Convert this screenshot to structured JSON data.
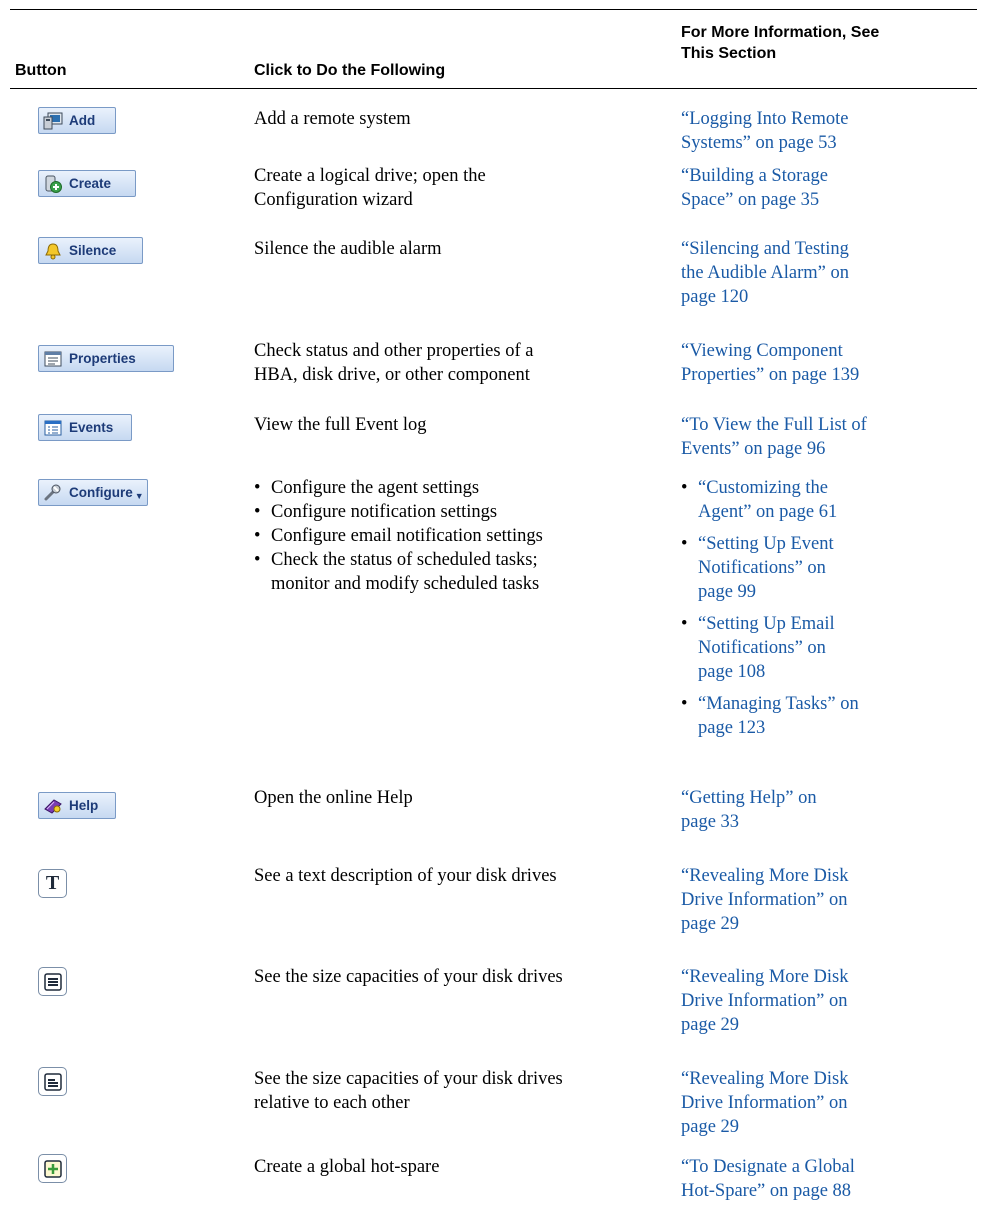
{
  "header": {
    "col1": "Button",
    "col2": "Click to Do the Following",
    "col3_line1": "For More Information, See",
    "col3_line2": "This Section"
  },
  "rows": [
    {
      "button": "Add",
      "desc": [
        "Add a remote system"
      ],
      "ref": [
        "“Logging Into Remote",
        "Systems” on page 53"
      ]
    },
    {
      "button": "Create",
      "desc": [
        "Create a logical drive; open the",
        "Configuration wizard"
      ],
      "ref": [
        "“Building a Storage",
        "Space” on page 35"
      ]
    },
    {
      "button": "Silence",
      "desc": [
        "Silence the audible alarm"
      ],
      "ref": [
        "“Silencing and Testing",
        "the Audible Alarm” on",
        "page 120"
      ]
    },
    {
      "button": "Properties",
      "desc": [
        "Check status and other properties of a",
        "HBA, disk drive, or other component"
      ],
      "ref": [
        "“Viewing Component",
        "Properties” on page 139"
      ]
    },
    {
      "button": "Events",
      "desc": [
        "View the full Event log"
      ],
      "ref": [
        "“To View the Full List of",
        "Events” on page 96"
      ]
    },
    {
      "button": "Configure",
      "desc_bullets": [
        [
          "Configure the agent settings"
        ],
        [
          "Configure notification settings"
        ],
        [
          "Configure email notification settings"
        ],
        [
          "Check the status of scheduled tasks;",
          "monitor and modify scheduled tasks"
        ]
      ],
      "ref_bullets": [
        [
          "“Customizing the",
          "Agent” on page 61"
        ],
        [
          "“Setting Up Event",
          "Notifications” on",
          "page 99"
        ],
        [
          "“Setting Up Email",
          "Notifications” on",
          "page 108"
        ],
        [
          "“Managing Tasks” on",
          "page 123"
        ]
      ]
    },
    {
      "button": "Help",
      "desc": [
        "Open the online Help"
      ],
      "ref": [
        "“Getting Help” on",
        "page 33"
      ]
    },
    {
      "button": "T",
      "desc": [
        "See a text description of your disk drives"
      ],
      "ref": [
        "“Revealing More Disk",
        "Drive Information” on",
        "page 29"
      ]
    },
    {
      "button": "",
      "desc": [
        "See the size capacities of your disk drives"
      ],
      "ref": [
        "“Revealing More Disk",
        "Drive Information” on",
        "page 29"
      ]
    },
    {
      "button": "",
      "desc": [
        "See the size capacities of your disk drives",
        "relative to each other"
      ],
      "ref": [
        "“Revealing More Disk",
        "Drive Information” on",
        "page 29"
      ]
    },
    {
      "button": "",
      "desc": [
        "Create a global hot-spare"
      ],
      "ref": [
        "“To Designate a Global",
        "Hot-Spare” on page 88"
      ]
    }
  ],
  "icons": {
    "add": "add-system-icon",
    "create": "create-drive-icon",
    "silence": "bell-icon",
    "properties": "properties-icon",
    "events": "events-icon",
    "configure": "wrench-icon",
    "help": "help-book-icon",
    "text": "text-view-icon",
    "full": "full-size-view-icon",
    "relative": "relative-size-view-icon",
    "hotspare": "plus-icon"
  },
  "colors": {
    "link": "#1a5aa6",
    "button_text": "#1d3b78",
    "button_border": "#7a9ac6"
  }
}
